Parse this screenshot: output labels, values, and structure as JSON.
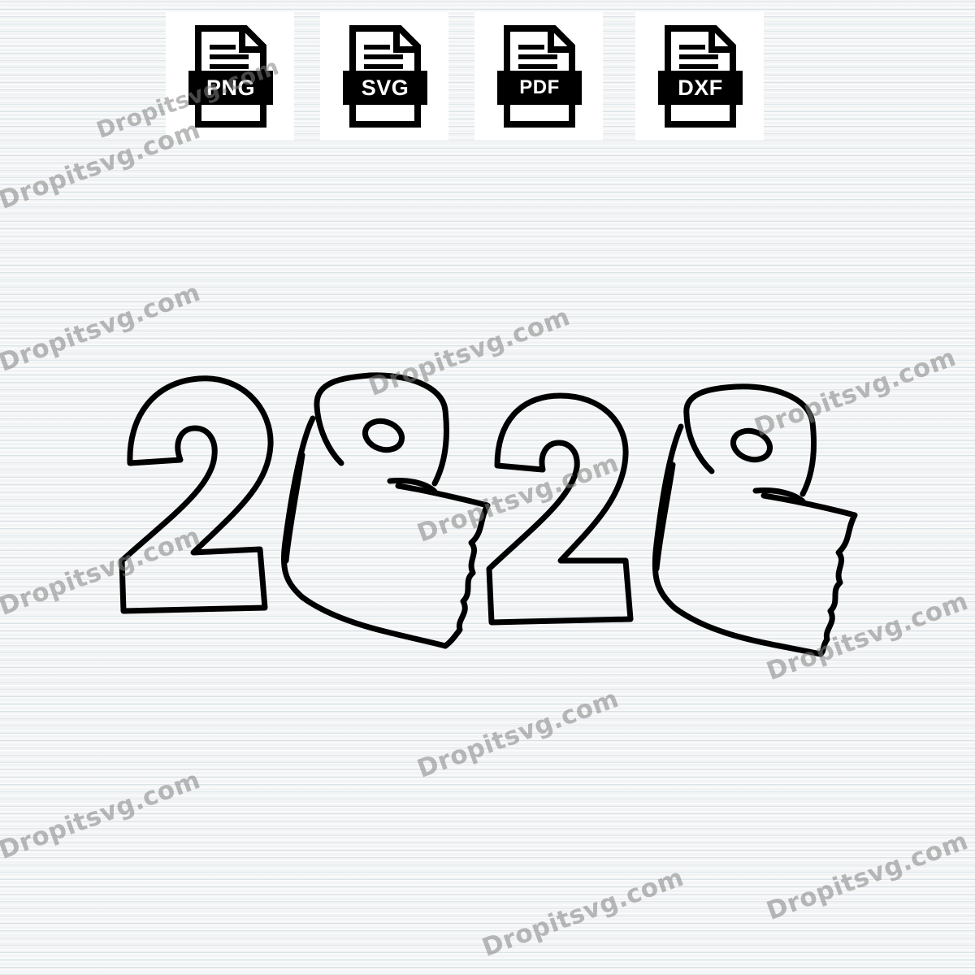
{
  "formats": [
    {
      "label": "PNG",
      "icon": "png-file-icon"
    },
    {
      "label": "SVG",
      "icon": "svg-file-icon"
    },
    {
      "label": "PDF",
      "icon": "pdf-file-icon"
    },
    {
      "label": "DXF",
      "icon": "dxf-file-icon"
    }
  ],
  "artwork": {
    "digits": [
      "2",
      "2"
    ],
    "rolls": [
      "toilet-paper-roll-icon",
      "toilet-paper-roll-icon"
    ],
    "stroke_color": "#000000"
  },
  "watermark": {
    "text": "Dropitsvg.com",
    "color": "#828282"
  },
  "colors": {
    "background": "#f1f3f4",
    "tile": "#ffffff",
    "icon": "#000000"
  }
}
